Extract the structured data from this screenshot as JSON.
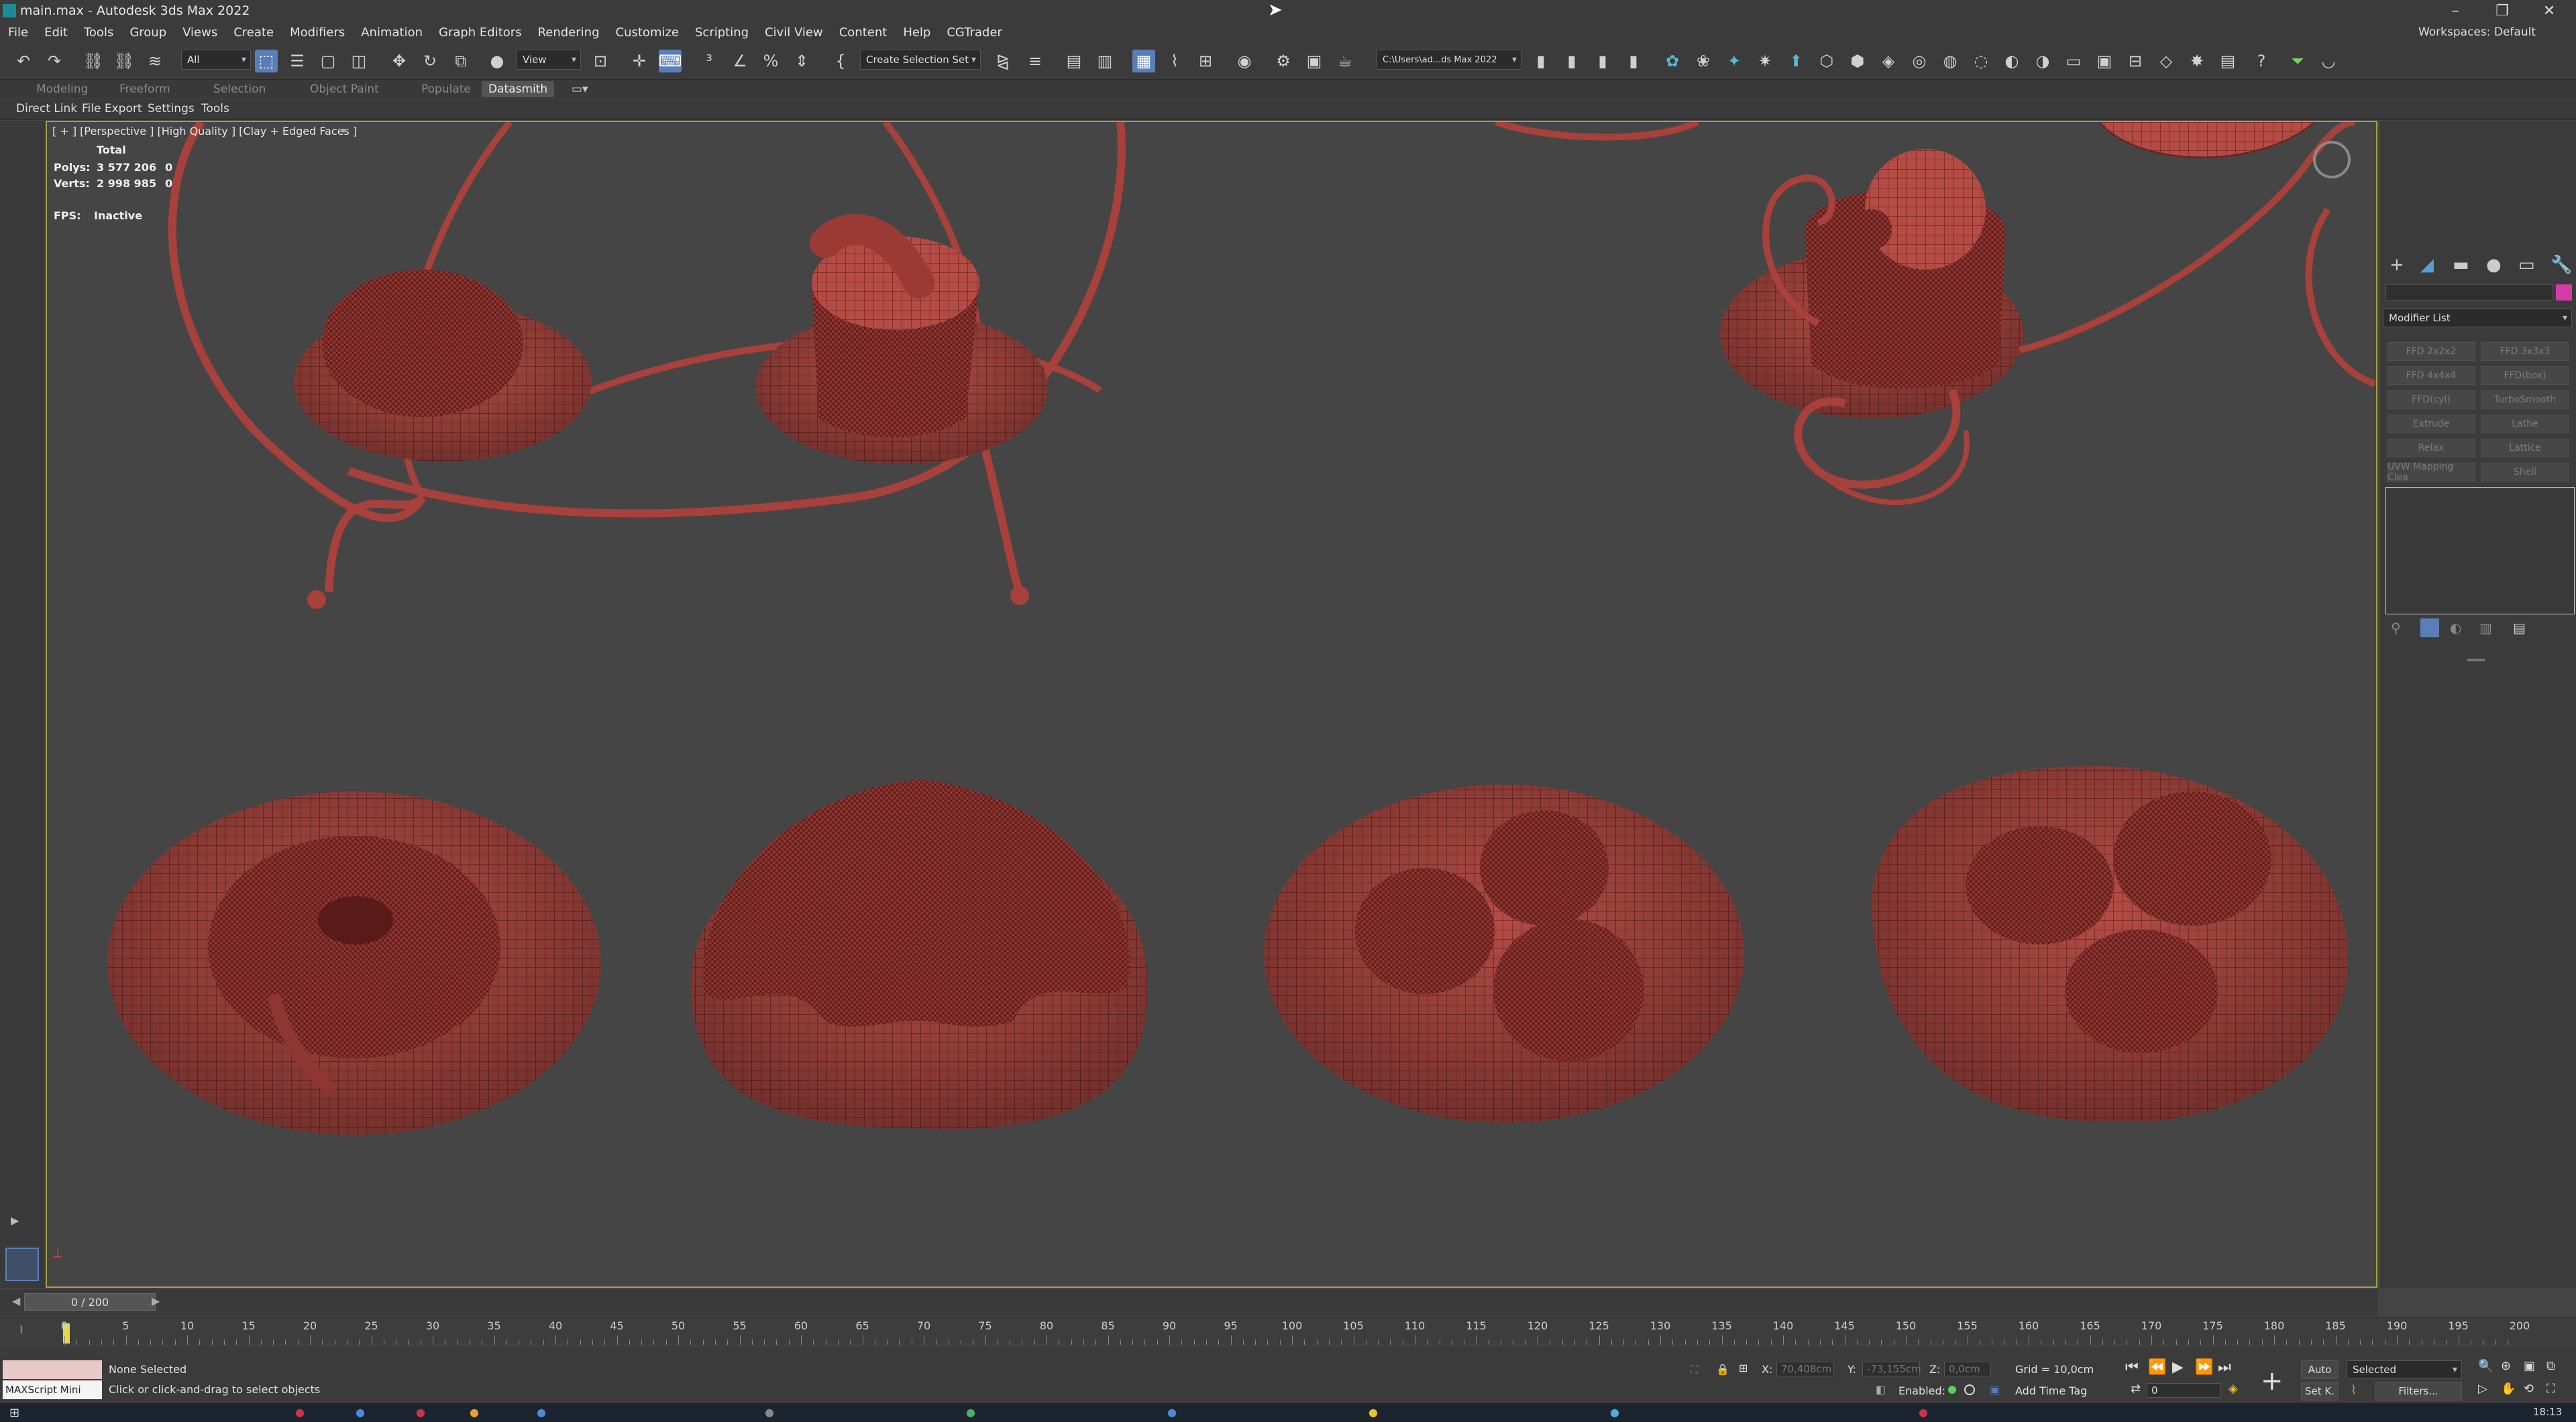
{
  "window": {
    "title": "main.max - Autodesk 3ds Max 2022"
  },
  "menu": {
    "items": [
      "File",
      "Edit",
      "Tools",
      "Group",
      "Views",
      "Create",
      "Modifiers",
      "Animation",
      "Graph Editors",
      "Rendering",
      "Customize",
      "Scripting",
      "Civil View",
      "Content",
      "Help",
      "CGTrader"
    ],
    "workspaces_label": "Workspaces: Default"
  },
  "toolbar": {
    "filter_value": "All",
    "refcoord_value": "View",
    "selection_set_value": "Create Selection Set",
    "project_path": "C:\\Users\\ad...ds Max 2022"
  },
  "ribbon": {
    "tabs": [
      "Modeling",
      "Freeform",
      "Selection",
      "Object Paint",
      "Populate",
      "Datasmith"
    ],
    "active_tab": "Datasmith",
    "subtabs": [
      "Direct Link",
      "File Export",
      "Settings",
      "Tools"
    ]
  },
  "viewport": {
    "label": "[ + ] [Perspective ] [High Quality ] [Clay + Edged Faces ]",
    "stats_header": "Total",
    "polys_label": "Polys:",
    "polys_total": "3 577 206",
    "polys_sel": "0",
    "verts_label": "Verts:",
    "verts_total": "2 998 985",
    "verts_sel": "0",
    "fps_label": "FPS:",
    "fps_value": "Inactive"
  },
  "command_panel": {
    "modifier_list": "Modifier List",
    "modifiers": [
      "FFD 2x2x2",
      "FFD 3x3x3",
      "FFD 4x4x4",
      "FFD(box)",
      "FFD(cyl)",
      "TurboSmooth",
      "Extrude",
      "Lathe",
      "Relax",
      "Lattice",
      "UVW Mapping Clea",
      "Shell"
    ]
  },
  "timeline": {
    "frame_display": "0 / 200",
    "ticks": [
      "0",
      "5",
      "10",
      "15",
      "20",
      "25",
      "30",
      "35",
      "40",
      "45",
      "50",
      "55",
      "60",
      "65",
      "70",
      "75",
      "80",
      "85",
      "90",
      "95",
      "100",
      "105",
      "110",
      "115",
      "120",
      "125",
      "130",
      "135",
      "140",
      "145",
      "150",
      "155",
      "160",
      "165",
      "170",
      "175",
      "180",
      "185",
      "190",
      "195",
      "200"
    ]
  },
  "status": {
    "maxscript_label": "MAXScript Mini",
    "selection": "None Selected",
    "prompt": "Click or click-and-drag to select objects",
    "x_label": "X:",
    "x_value": "70,408cm",
    "y_label": "Y:",
    "y_value": "-73,155cm",
    "z_label": "Z:",
    "z_value": "0,0cm",
    "grid": "Grid = 10,0cm",
    "enabled": "Enabled:",
    "add_time_tag": "Add Time Tag",
    "auto": "Auto",
    "set_key": "Set K.",
    "key_filter": "Selected",
    "filters": "Filters...",
    "frame_field": "0"
  },
  "clock": "18:13",
  "colors": {
    "clay": "#b34c45",
    "wire": "#6e1f1c",
    "accent": "#5a7fb8",
    "viewport_border": "#a7a03a"
  }
}
